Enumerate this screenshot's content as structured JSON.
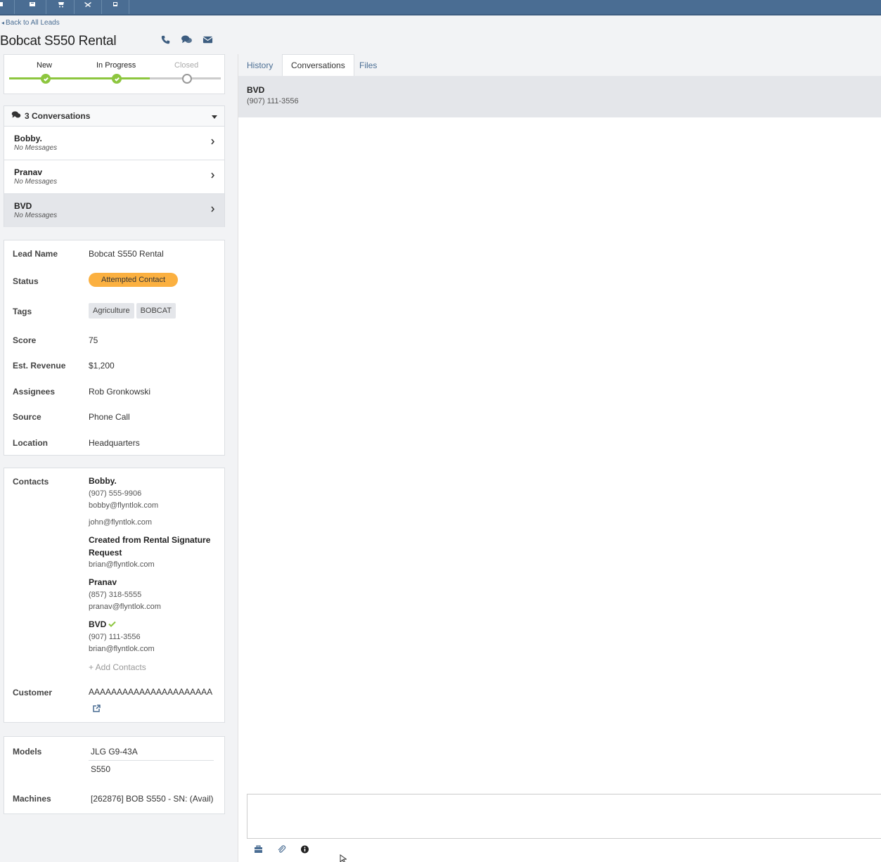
{
  "toolbar": {
    "icons": [
      "file-icon",
      "edit-icon",
      "cart-icon",
      "tools-icon",
      "clipboard-icon"
    ]
  },
  "nav": {
    "back_label": "Back to All Leads"
  },
  "lead": {
    "title": "Bobcat S550 Rental"
  },
  "pipeline": {
    "stages": [
      {
        "label": "New",
        "status": "done"
      },
      {
        "label": "In Progress",
        "status": "done"
      },
      {
        "label": "Closed",
        "status": "todo"
      }
    ]
  },
  "conversations": {
    "header": "3 Conversations",
    "items": [
      {
        "name": "Bobby.",
        "sub": "No Messages"
      },
      {
        "name": "Pranav",
        "sub": "No Messages"
      },
      {
        "name": "BVD",
        "sub": "No Messages"
      }
    ]
  },
  "details": {
    "lead_name_label": "Lead Name",
    "lead_name": "Bobcat S550 Rental",
    "status_label": "Status",
    "status": "Attempted Contact",
    "status_color": "#fbb040",
    "tags_label": "Tags",
    "tags": [
      "Agriculture",
      "BOBCAT"
    ],
    "score_label": "Score",
    "score": "75",
    "revenue_label": "Est. Revenue",
    "revenue": "$1,200",
    "assignees_label": "Assignees",
    "assignees": "Rob Gronkowski",
    "source_label": "Source",
    "source": "Phone Call",
    "location_label": "Location",
    "location": "Headquarters"
  },
  "contacts": {
    "label": "Contacts",
    "list": [
      {
        "name": "Bobby.",
        "phone": "(907) 555-9906",
        "email": "bobby@flyntlok.com"
      },
      {
        "name": "",
        "phone": "",
        "email": "john@flyntlok.com"
      },
      {
        "name": "Created from Rental Signature Request",
        "phone": "",
        "email": "brian@flyntlok.com"
      },
      {
        "name": "Pranav",
        "phone": "(857) 318-5555",
        "email": "pranav@flyntlok.com"
      },
      {
        "name": "BVD",
        "phone": "(907) 111-3556",
        "email": "brian@flyntlok.com"
      }
    ],
    "add_label": "+ Add Contacts",
    "customer_label": "Customer",
    "customer": "AAAAAAAAAAAAAAAAAAAAAA"
  },
  "models": {
    "label": "Models",
    "items": [
      "JLG G9-43A",
      "S550"
    ],
    "machines_label": "Machines",
    "machines": "[262876] BOB S550 - SN: (Avail)"
  },
  "right": {
    "tabs": [
      "History",
      "Conversations",
      "Files"
    ],
    "active_tab": "Conversations",
    "conv_name": "BVD",
    "conv_phone": "(907) 111-3556"
  },
  "colors": {
    "brand": "#4a6d93",
    "progress": "#8dc63f",
    "status": "#fbb040"
  }
}
